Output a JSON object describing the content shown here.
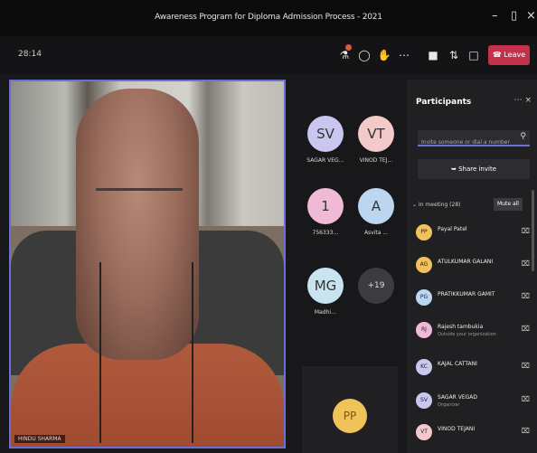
{
  "window": {
    "title": "Awareness Program for Diploma Admission Process - 2021",
    "minimize_glyph": "–",
    "maximize_glyph": "▯",
    "close_glyph": "×"
  },
  "toolbar": {
    "timer": "28:14",
    "leave_label": "Leave",
    "icons": [
      "participants-icon",
      "chat-icon",
      "raise-hand-icon",
      "more-icon",
      "camera-icon",
      "mic-icon",
      "share-icon"
    ]
  },
  "main_video": {
    "speaker_name": "HINDU SHARMA"
  },
  "gallery": {
    "tiles": [
      {
        "initials": "SV",
        "name": "SAGAR VEG…",
        "color": "#c9c6f0"
      },
      {
        "initials": "VT",
        "name": "VINOD TEJ…",
        "color": "#f3c9c9"
      },
      {
        "initials": "1",
        "name": "756333…",
        "color": "#f0b9d6"
      },
      {
        "initials": "A",
        "name": "Asvita ...",
        "color": "#bcd6f2"
      },
      {
        "initials": "MG",
        "name": "Madhi…",
        "color": "#c7e4f0"
      },
      {
        "initials": "+19",
        "name": "",
        "color": "#3c3c40"
      }
    ],
    "bottom_tile_initials": "PP"
  },
  "participants": {
    "title": "Participants",
    "search_placeholder": "Invite someone or dial a number",
    "share_invite_label": "Share invite",
    "in_meeting_label": "In meeting (28)",
    "mute_all_label": "Mute all",
    "list": [
      {
        "initials": "PP",
        "name": "Payal Patel",
        "sub": "",
        "color": "#f0c35a"
      },
      {
        "initials": "AG",
        "name": "ATULKUMAR GALANI",
        "sub": "",
        "color": "#f0c35a"
      },
      {
        "initials": "PG",
        "name": "PRATIKKUMAR GAMIT",
        "sub": "",
        "color": "#bcd6f2"
      },
      {
        "initials": "RJ",
        "name": "Rajesh tambukia",
        "sub": "Outside your organization",
        "color": "#f0b9d6"
      },
      {
        "initials": "KC",
        "name": "KAJAL CATTANI",
        "sub": "",
        "color": "#c9c6f0"
      },
      {
        "initials": "SV",
        "name": "SAGAR VEGAD",
        "sub": "Organizer",
        "color": "#c9c6f0"
      },
      {
        "initials": "VT",
        "name": "VINOD TEJANI",
        "sub": "",
        "color": "#f3c9c9"
      }
    ]
  }
}
